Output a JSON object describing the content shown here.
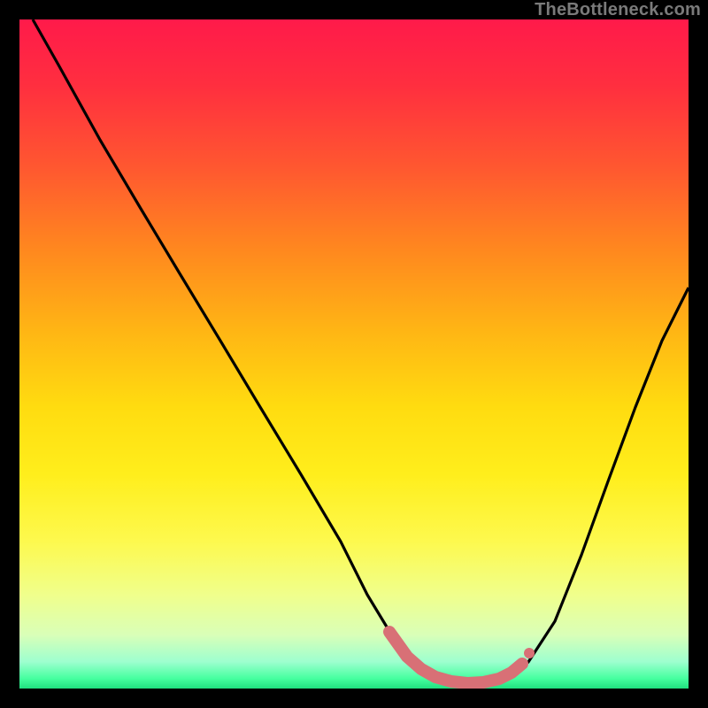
{
  "watermark": "TheBottleneck.com",
  "chart_data": {
    "type": "line",
    "title": "",
    "xlabel": "",
    "ylabel": "",
    "xlim": [
      0,
      100
    ],
    "ylim": [
      0,
      100
    ],
    "grid": false,
    "legend": false,
    "series": [
      {
        "name": "bottleneck-curve",
        "x": [
          2,
          6,
          12,
          18,
          24,
          30,
          36,
          42,
          48,
          52,
          55,
          58,
          62,
          66,
          70,
          74,
          76,
          80,
          84,
          88,
          92,
          96,
          100
        ],
        "y": [
          100,
          93,
          82,
          72,
          62,
          52,
          42,
          32,
          22,
          14,
          9,
          5,
          2,
          1,
          1,
          2,
          4,
          10,
          20,
          31,
          42,
          52,
          60
        ]
      },
      {
        "name": "optimal-zone",
        "x": [
          55,
          58,
          62,
          66,
          70,
          74,
          76
        ],
        "y": [
          9,
          5,
          2,
          1,
          1,
          2,
          4
        ]
      }
    ],
    "annotations": [],
    "background": {
      "type": "vertical-gradient",
      "stops": [
        {
          "pos": 0.0,
          "color": "#ff1a4a"
        },
        {
          "pos": 0.5,
          "color": "#ffdc10"
        },
        {
          "pos": 0.9,
          "color": "#d9ffb8"
        },
        {
          "pos": 1.0,
          "color": "#20e07f"
        }
      ]
    }
  }
}
